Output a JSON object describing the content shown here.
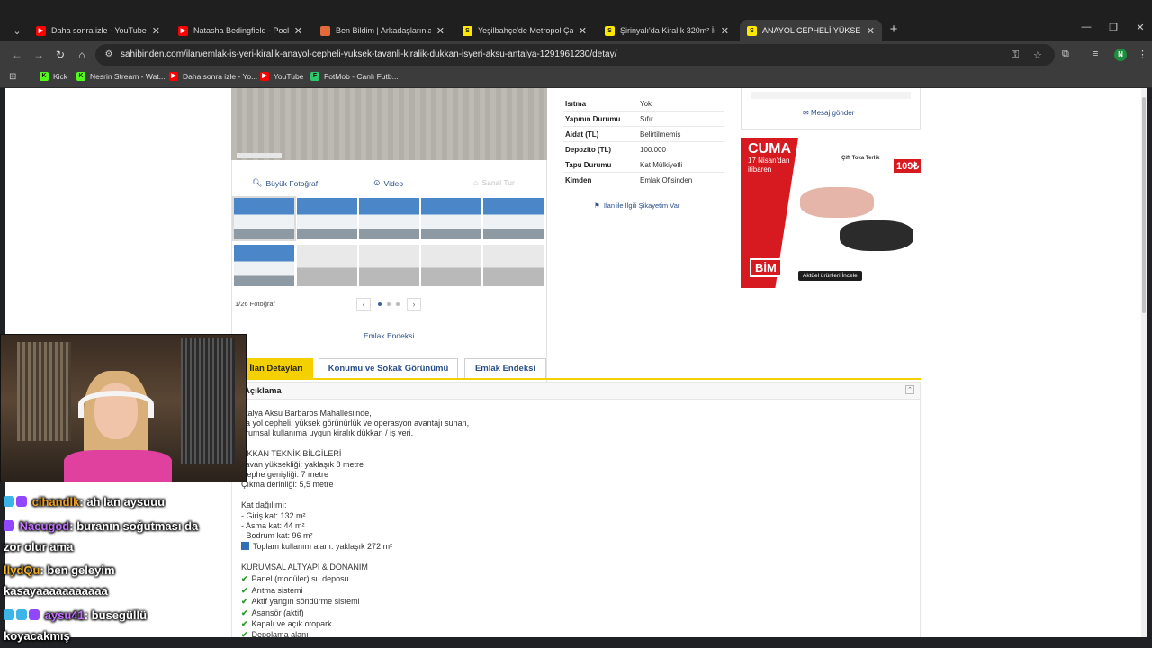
{
  "tabs": [
    {
      "title": "Daha sonra izle - YouTube",
      "fav": "youtube-icon"
    },
    {
      "title": "Natasha Bedingfield - Pocketf",
      "fav": "youtube-icon"
    },
    {
      "title": "Ben Bildim | Arkadaşlarınla Onl",
      "fav": "game-icon"
    },
    {
      "title": "Yeşilbahçe'de Metropol Çarşı",
      "fav": "sahibinden-icon"
    },
    {
      "title": "Şirinyalı'da Kiralık 320m² İş Yeri",
      "fav": "sahibinden-icon"
    },
    {
      "title": "ANAYOL CEPHELİ YÜKSEK TAVA",
      "fav": "sahibinden-icon"
    }
  ],
  "url": "sahibinden.com/ilan/emlak-is-yeri-kiralik-anayol-cepheli-yuksek-tavanli-kiralik-dukkan-isyeri-aksu-antalya-1291961230/detay/",
  "bookmarks": [
    {
      "label": "Kick"
    },
    {
      "label": "Nesrin Stream - Wat..."
    },
    {
      "label": "Daha sonra izle - Yo..."
    },
    {
      "label": "YouTube"
    },
    {
      "label": "FotMob - Canlı Futb..."
    }
  ],
  "profile_initial": "N",
  "photo_controls": {
    "big_photo": "Büyük Fotoğraf",
    "video": "Video",
    "virtual_tour": "Sanal Tur",
    "count": "1/26 Fotoğraf",
    "emlak_link": "Emlak Endeksi"
  },
  "info": [
    {
      "k": "Isıtma",
      "v": "Yok"
    },
    {
      "k": "Yapının Durumu",
      "v": "Sıfır"
    },
    {
      "k": "Aidat (TL)",
      "v": "Belirtilmemiş"
    },
    {
      "k": "Depozito (TL)",
      "v": "100.000"
    },
    {
      "k": "Tapu Durumu",
      "v": "Kat Mülkiyetli"
    },
    {
      "k": "Kimden",
      "v": "Emlak Ofisinden"
    }
  ],
  "complaint": "İlan ile İlgili Şikayetim Var",
  "message": "Mesaj gönder",
  "ad": {
    "headline": "CUMA",
    "date": "17 Nisan'dan itibaren",
    "product": "Çift Toka Terlik",
    "price": "109₺",
    "brand": "BİM",
    "cta": "Aktüel ürünleri İncele"
  },
  "page_tabs": [
    "İlan Detayları",
    "Konumu ve Sokak Görünümü",
    "Emlak Endeksi"
  ],
  "desc_title": "Açıklama",
  "desc": [
    "ntalya Aksu Barbaros Mahallesi'nde,",
    "na yol cepheli, yüksek görünürlük ve operasyon avantajı sunan,",
    "urumsal kullanıma uygun kiralık dükkan / iş yeri.",
    "ÜKKAN TEKNİK BİLGİLERİ",
    "Tavan yüksekliği: yaklaşık 8 metre",
    "Cephe genişliği: 7 metre",
    "Çıkma derinliği: 5,5 metre",
    "Kat dağılımı:",
    "- Giriş kat: 132 m²",
    "- Asma kat: 44 m²",
    "- Bodrum kat: 96 m²",
    "Toplam kullanım alanı: yaklaşık 272 m²",
    "KURUMSAL ALTYAPI & DONANIM",
    "Panel (modüler) su deposu",
    "Arıtma sistemi",
    "Aktif yangın söndürme sistemi",
    "Asansör (aktif)",
    "Kapalı ve açık otopark",
    "Depolama alanı"
  ],
  "chat": [
    {
      "user": "cihandlk",
      "msg": ": ah lan aysuuu"
    },
    {
      "user": "Nacugod",
      "msg": ": buranın soğutması da"
    },
    {
      "user": "",
      "msg": "zor olur ama"
    },
    {
      "user": "llydQu",
      "msg": ": ben geleyim"
    },
    {
      "user": "",
      "msg": "kasayaaaaaaaaaaa"
    },
    {
      "user": "aysu41",
      "msg": ": busegüllü"
    },
    {
      "user": "",
      "msg": "koyacakmış"
    }
  ]
}
